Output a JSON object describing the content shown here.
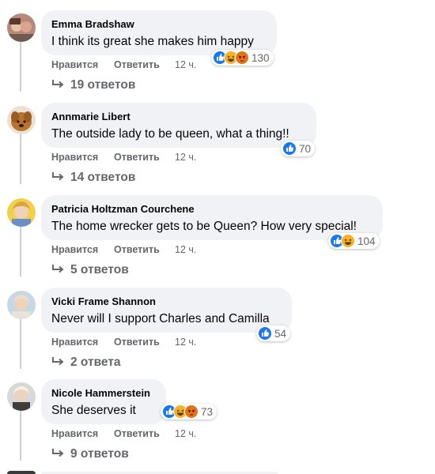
{
  "ui": {
    "like_label": "Нравится",
    "reply_label": "Ответить",
    "colors": {
      "bubble": "#f0f2f5",
      "secondary_text": "#65676b",
      "like_blue": "#1877f2",
      "haha_yellow": "#f7b125",
      "angry_orange": "#e9710f"
    }
  },
  "comments": [
    {
      "author": "Emma Bradshaw",
      "text": "I think its great she makes him happy",
      "time": "12 ч.",
      "reactions": [
        "like-icon",
        "haha-icon",
        "angry-icon"
      ],
      "reaction_count": "130",
      "replies": "19 ответов"
    },
    {
      "author": "Annmarie Libert",
      "text": "The outside lady to be queen, what a thing!!",
      "time": "12 ч.",
      "reactions": [
        "like-icon"
      ],
      "reaction_count": "70",
      "replies": "14 ответов"
    },
    {
      "author": "Patricia Holtzman Courchene",
      "text": "The home wrecker gets to be Queen? How very special!",
      "time": "12 ч.",
      "reactions": [
        "like-icon",
        "haha-icon"
      ],
      "reaction_count": "104",
      "replies": "5 ответов"
    },
    {
      "author": "Vicki Frame Shannon",
      "text": "Never will I support Charles and Camilla",
      "time": "12 ч.",
      "reactions": [
        "like-icon"
      ],
      "reaction_count": "54",
      "replies": "2 ответа"
    },
    {
      "author": "Nicole Hammerstein",
      "text": "She deserves it",
      "time": "12 ч.",
      "reactions": [
        "like-icon",
        "haha-icon",
        "angry-icon"
      ],
      "reaction_count": "73",
      "replies": "9 ответов"
    }
  ]
}
